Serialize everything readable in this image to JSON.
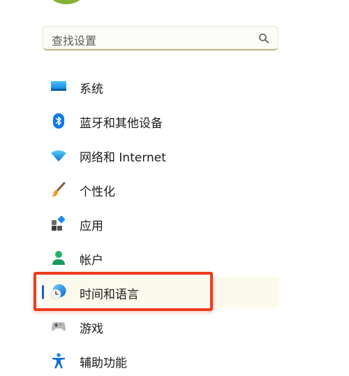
{
  "search": {
    "placeholder": "查找设置"
  },
  "nav": {
    "items": [
      {
        "label": "系统",
        "icon": "system-display-icon"
      },
      {
        "label": "蓝牙和其他设备",
        "icon": "bluetooth-icon"
      },
      {
        "label": "网络和 Internet",
        "icon": "wifi-icon"
      },
      {
        "label": "个性化",
        "icon": "paintbrush-icon"
      },
      {
        "label": "应用",
        "icon": "apps-icon"
      },
      {
        "label": "帐户",
        "icon": "account-icon"
      },
      {
        "label": "时间和语言",
        "icon": "time-language-icon"
      },
      {
        "label": "游戏",
        "icon": "gamepad-icon"
      },
      {
        "label": "辅助功能",
        "icon": "accessibility-icon"
      }
    ],
    "selected_index": 6
  },
  "colors": {
    "accent": "#1b5bd1",
    "highlight": "#ee3c1c",
    "selected_background": "#fbfaec"
  }
}
